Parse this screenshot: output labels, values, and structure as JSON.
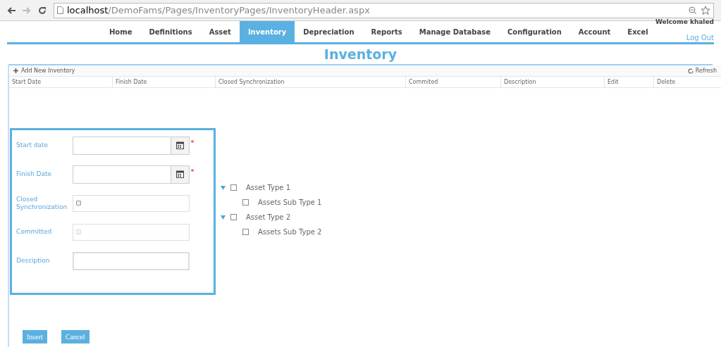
{
  "browser": {
    "url_host": "localhost",
    "url_path": "/DemoFams/Pages/InventoryPages/InventoryHeader.aspx"
  },
  "nav": {
    "items": [
      {
        "label": "Home",
        "selected": false
      },
      {
        "label": "Definitions",
        "selected": false
      },
      {
        "label": "Asset",
        "selected": false
      },
      {
        "label": "Inventory",
        "selected": true
      },
      {
        "label": "Depreciation",
        "selected": false
      },
      {
        "label": "Reports",
        "selected": false
      },
      {
        "label": "Manage Database",
        "selected": false
      },
      {
        "label": "Configuration",
        "selected": false
      },
      {
        "label": "Account",
        "selected": false
      },
      {
        "label": "Excel",
        "selected": false
      }
    ],
    "welcome": "Welcome khaled",
    "logout": "Log Out"
  },
  "title": "Inventory",
  "grid": {
    "add": "Add New Inventory",
    "refresh": "Refresh",
    "columns": [
      "Start Date",
      "Finish Date",
      "Closed Synchronization",
      "Commited",
      "Description",
      "Edit",
      "Delete"
    ]
  },
  "form": {
    "fields": [
      {
        "kind": "date",
        "label": "Start date",
        "required": true
      },
      {
        "kind": "date",
        "label": "Finish Date",
        "required": true
      },
      {
        "kind": "checkbox",
        "label": "Closed Synchronization",
        "checked": false,
        "disabled": false
      },
      {
        "kind": "checkbox",
        "label": "Committed",
        "checked": false,
        "disabled": true
      },
      {
        "kind": "text",
        "label": "Desciption"
      }
    ]
  },
  "tree": [
    {
      "label": "Asset Type 1",
      "expanded": true,
      "checked": false,
      "children": [
        {
          "label": "Assets Sub Type 1",
          "checked": false
        }
      ]
    },
    {
      "label": "Asset Type 2",
      "expanded": true,
      "checked": false,
      "children": [
        {
          "label": "Assets Sub Type 2",
          "checked": false
        }
      ]
    }
  ],
  "buttons": [
    "Insert",
    "Cancel"
  ]
}
